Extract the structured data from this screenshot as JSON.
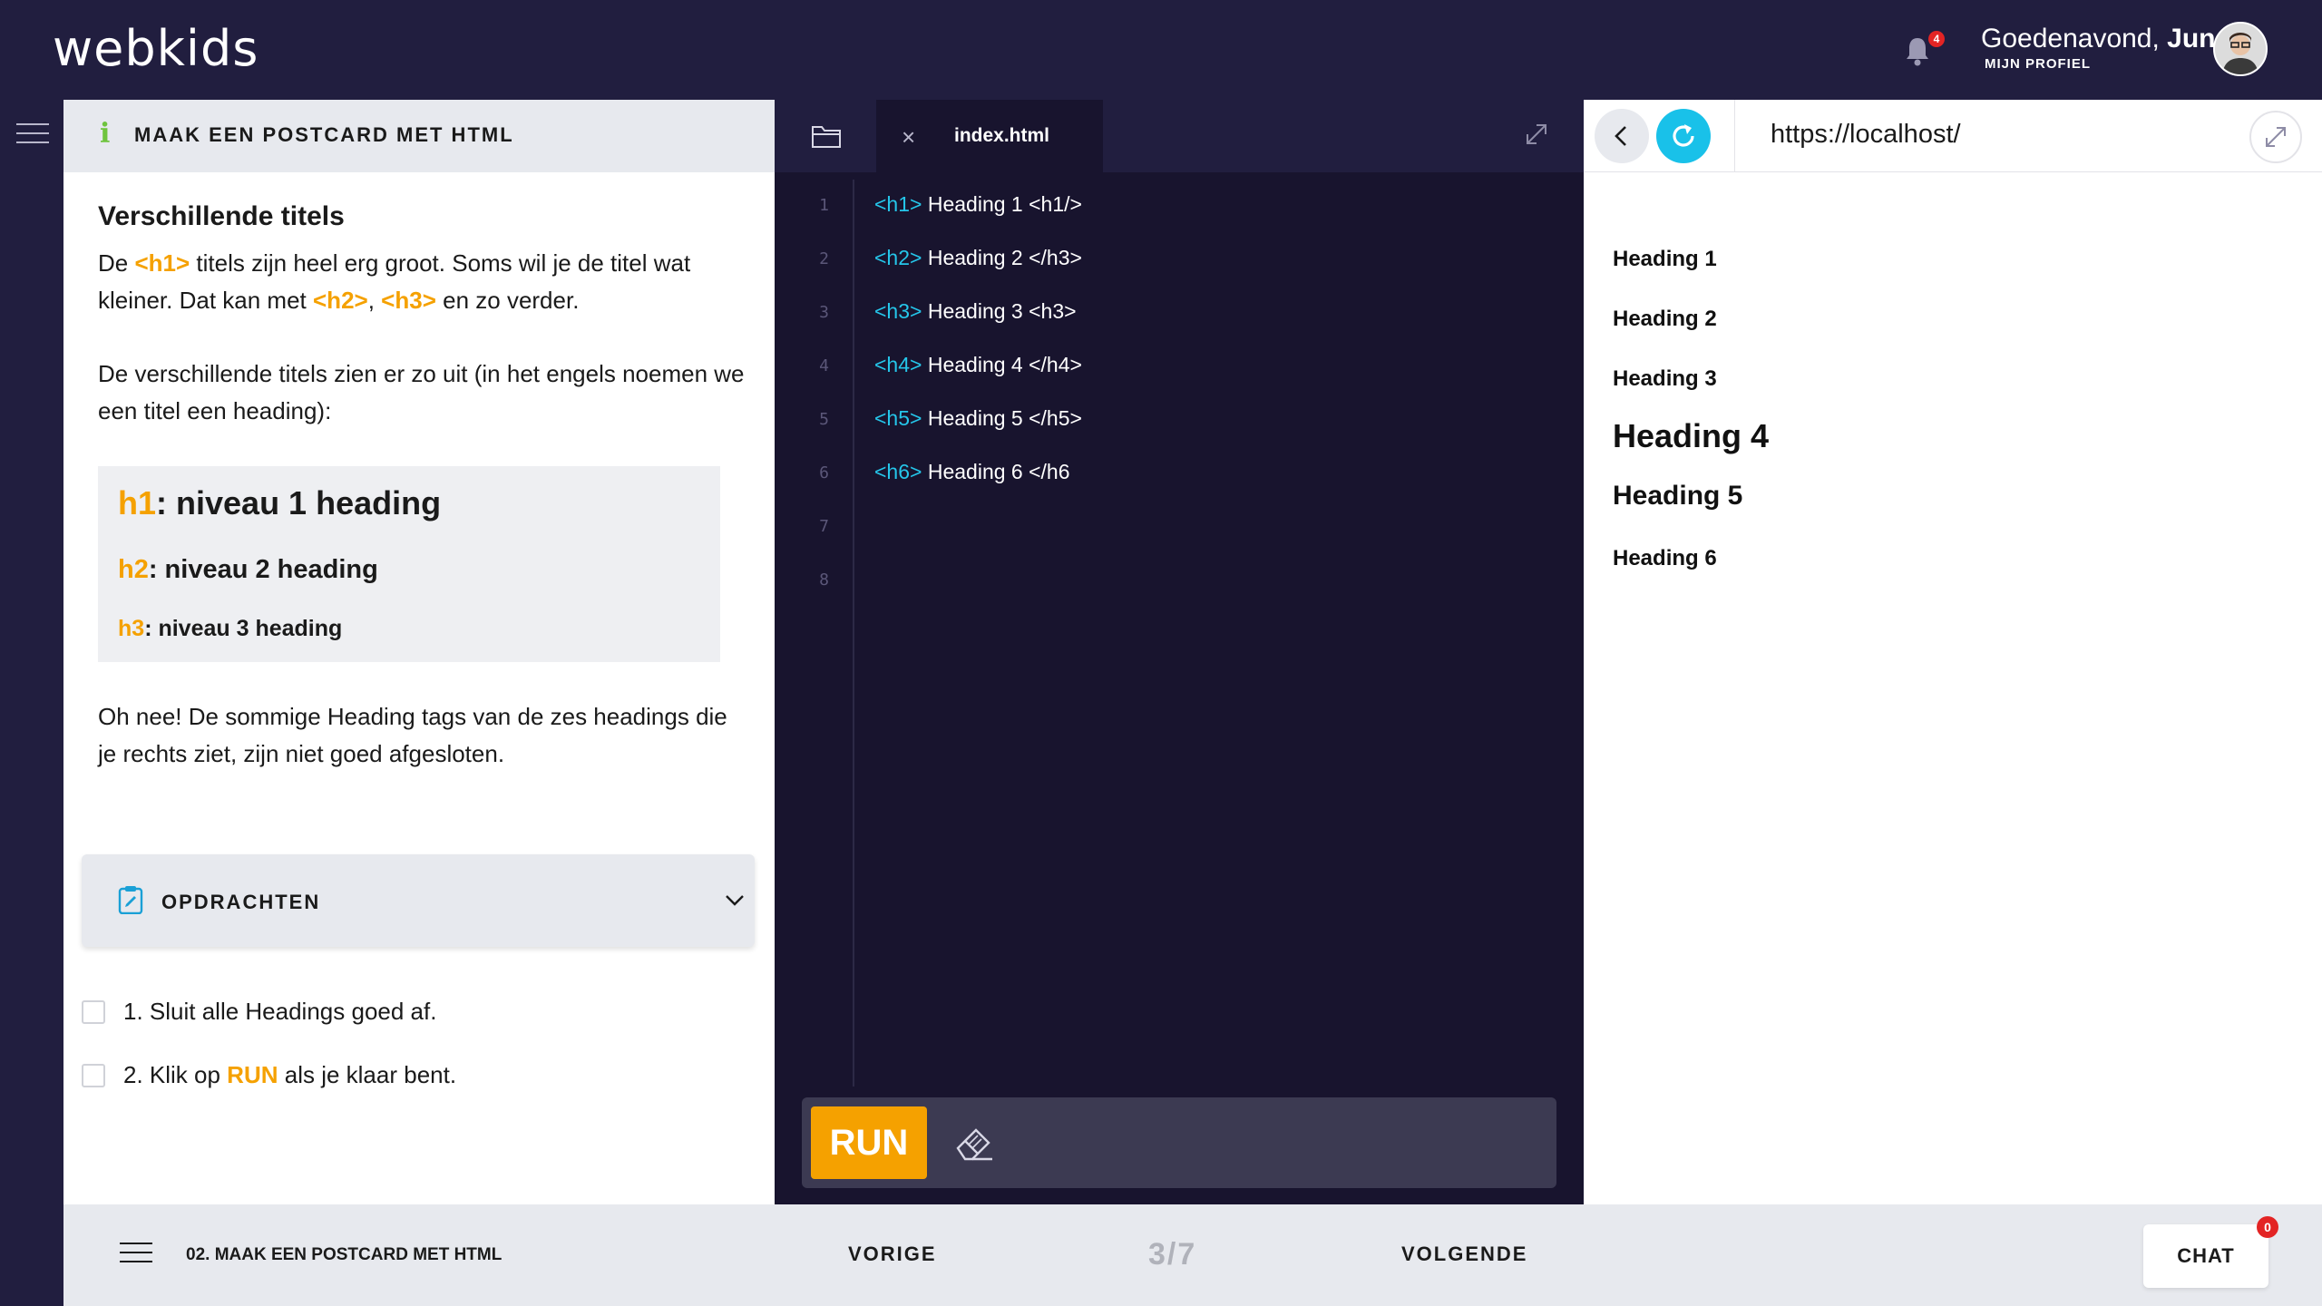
{
  "app": {
    "logo": "webkids",
    "notifications_count": "4",
    "greeting_prefix": "Goedenavond, ",
    "user_name": "Jun",
    "profile_link": "MIJN PROFIEL"
  },
  "lesson": {
    "header_title": "MAAK EEN POSTCARD MET HTML",
    "heading": "Verschillende titels",
    "p1_a": "De ",
    "p1_tag1": "<h1>",
    "p1_b": " titels zijn heel erg groot. Soms wil je de titel wat kleiner. Dat kan met ",
    "p1_tag2": "<h2>",
    "p1_c": ", ",
    "p1_tag3": "<h3>",
    "p1_d": " en zo verder.",
    "p2": "De verschillende titels zien er zo uit (in het engels noemen we een titel een heading):",
    "levels": [
      {
        "key": "h1",
        "text": ": niveau 1 heading"
      },
      {
        "key": "h2",
        "text": ": niveau 2 heading"
      },
      {
        "key": "h3",
        "text": ": niveau 3 heading"
      }
    ],
    "p3": "Oh nee! De sommige Heading tags van de zes headings die je rechts ziet, zijn niet goed afgesloten.",
    "assignments_title": "OPDRACHTEN",
    "task1": "1. Sluit alle Headings goed af.",
    "task2_a": "2. Klik op ",
    "task2_run": "RUN",
    "task2_b": " als je klaar bent."
  },
  "editor": {
    "tab_name": "index.html",
    "lines": [
      {
        "n": "1",
        "tag": "<h1>",
        "rest": " Heading 1 <h1/>"
      },
      {
        "n": "2",
        "tag": "<h2>",
        "rest": " Heading 2 </h3>"
      },
      {
        "n": "3",
        "tag": "<h3>",
        "rest": " Heading 3 <h3>"
      },
      {
        "n": "4",
        "tag": "<h4>",
        "rest": " Heading 4 </h4>"
      },
      {
        "n": "5",
        "tag": "<h5>",
        "rest": " Heading 5 </h5>"
      },
      {
        "n": "6",
        "tag": "<h6>",
        "rest": " Heading 6 </h6"
      },
      {
        "n": "7",
        "tag": "",
        "rest": ""
      },
      {
        "n": "8",
        "tag": "",
        "rest": ""
      }
    ],
    "run_label": "RUN"
  },
  "preview": {
    "url": "https://localhost/",
    "headings": [
      "Heading 1",
      "Heading 2",
      "Heading 3",
      "Heading 4",
      "Heading 5",
      "Heading 6"
    ]
  },
  "footer": {
    "course_title": "02. MAAK EEN POSTCARD MET HTML",
    "prev_label": "VORIGE",
    "page": "3/7",
    "next_label": "VOLGENDE",
    "chat_label": "CHAT",
    "chat_count": "0"
  }
}
